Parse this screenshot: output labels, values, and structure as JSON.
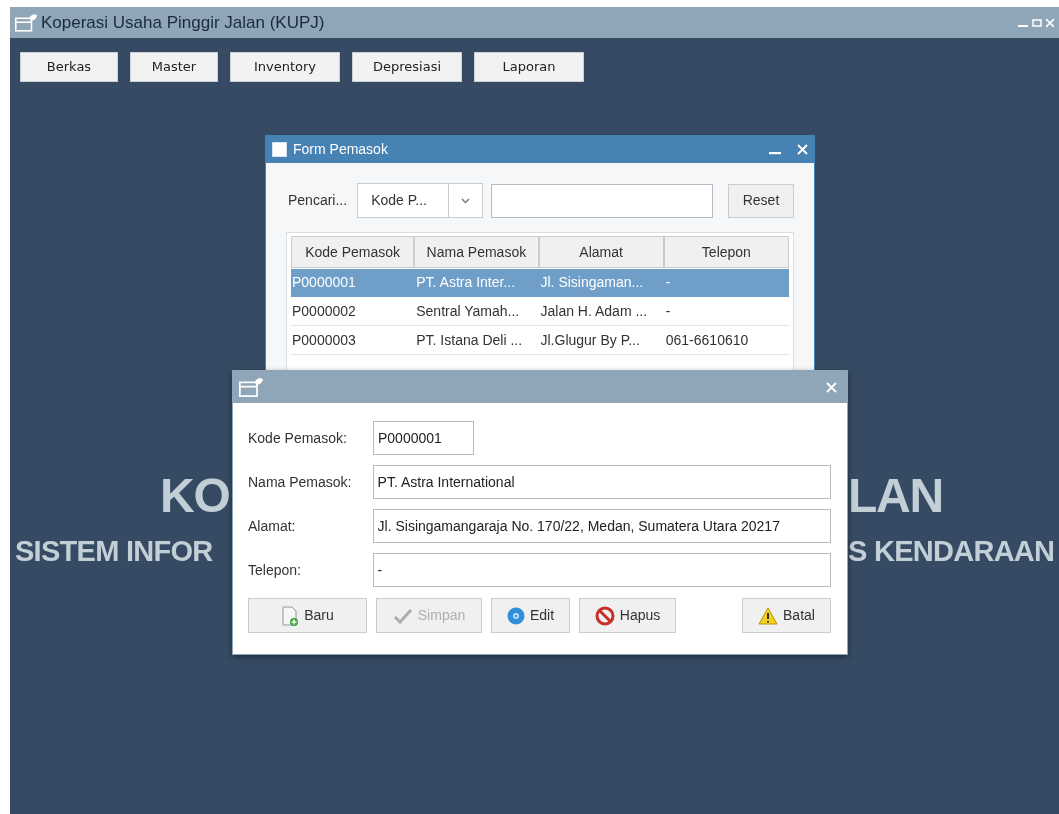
{
  "window": {
    "title": "Koperasi Usaha Pinggir Jalan (KUPJ)"
  },
  "menu": [
    "Berkas",
    "Master",
    "Inventory",
    "Depresiasi",
    "Laporan"
  ],
  "banner": {
    "line1_left": "KO",
    "line1_right": "LAN",
    "line2_left": "SISTEM INFOR",
    "line2_right": "S KENDARAAN"
  },
  "form_pemasok": {
    "title": "Form Pemasok",
    "search_label": "Pencari...",
    "search_by": "Kode P...",
    "reset_button": "Reset",
    "table": {
      "columns": [
        "Kode Pemasok",
        "Nama Pemasok",
        "Alamat",
        "Telepon"
      ],
      "rows": [
        {
          "cells": [
            "P0000001",
            "PT. Astra Inter...",
            "Jl. Sisingaman...",
            "-"
          ],
          "selected": true
        },
        {
          "cells": [
            "P0000002",
            "Sentral Yamah...",
            "Jalan H. Adam ...",
            "-"
          ],
          "selected": false
        },
        {
          "cells": [
            "P0000003",
            "PT. Istana Deli ...",
            "Jl.Glugur By P...",
            "061-6610610"
          ],
          "selected": false
        }
      ]
    }
  },
  "dialog": {
    "fields": [
      {
        "label": "Kode Pemasok:",
        "value": "P0000001",
        "kind": "short"
      },
      {
        "label": "Nama Pemasok:",
        "value": "PT. Astra International",
        "kind": "wide"
      },
      {
        "label": "Alamat:",
        "value": "Jl. Sisingamangaraja No. 170/22, Medan, Sumatera Utara 20217",
        "kind": "wide"
      },
      {
        "label": "Telepon:",
        "value": "-",
        "kind": "wide"
      }
    ],
    "buttons": [
      {
        "label": "Baru",
        "kind": "new",
        "disabled": false
      },
      {
        "label": "Simpan",
        "kind": "save",
        "disabled": true
      },
      {
        "label": "Edit",
        "kind": "edit",
        "disabled": false
      },
      {
        "label": "Hapus",
        "kind": "delete",
        "disabled": false
      },
      {
        "label": "Batal",
        "kind": "cancel",
        "disabled": false
      }
    ]
  }
}
